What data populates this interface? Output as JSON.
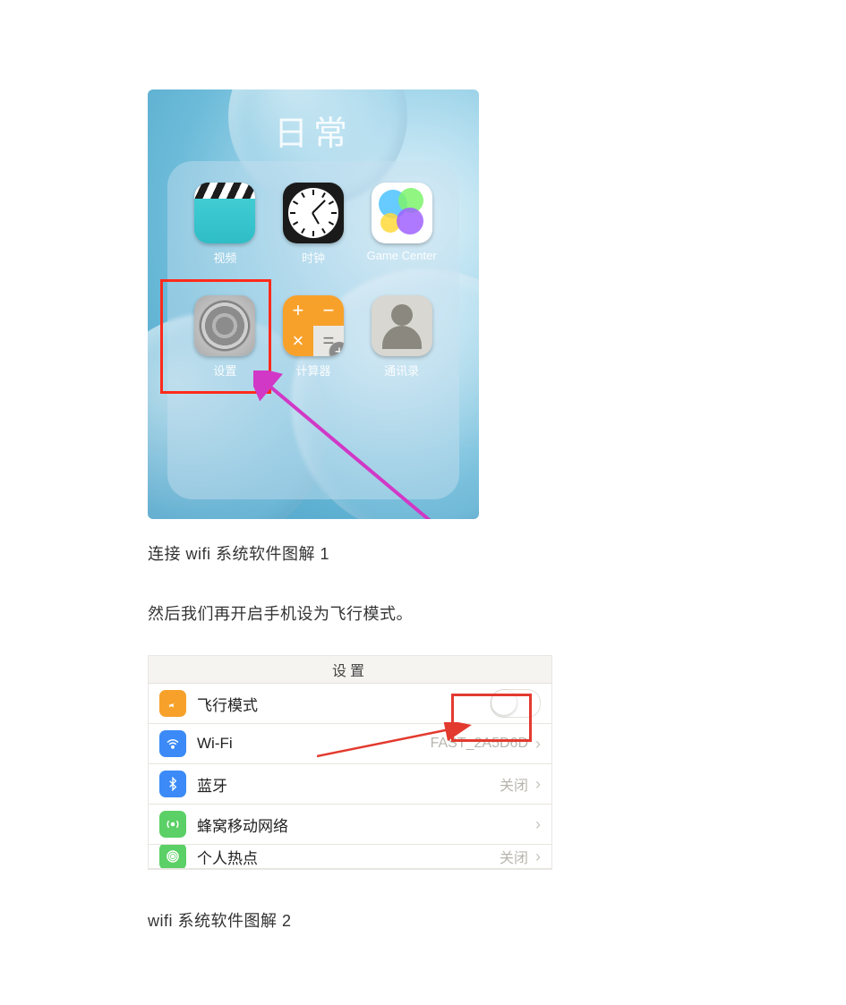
{
  "folder": {
    "title": "日常",
    "apps": [
      {
        "label": "视频"
      },
      {
        "label": "时钟"
      },
      {
        "label": "Game Center"
      },
      {
        "label": "设置"
      },
      {
        "label": "计算器"
      },
      {
        "label": "通讯录"
      }
    ]
  },
  "caption1": "连接 wifi 系统软件图解 1",
  "para1": "然后我们再开启手机设为飞行模式。",
  "settings": {
    "header": "设置",
    "rows": {
      "airplane": {
        "label": "飞行模式"
      },
      "wifi": {
        "label": "Wi-Fi",
        "value": "FAST_2A5D6D"
      },
      "bt": {
        "label": "蓝牙",
        "value": "关闭"
      },
      "cell": {
        "label": "蜂窝移动网络"
      },
      "hotspot": {
        "label": "个人热点",
        "value": "关闭"
      }
    }
  },
  "caption2": "wifi 系统软件图解 2"
}
